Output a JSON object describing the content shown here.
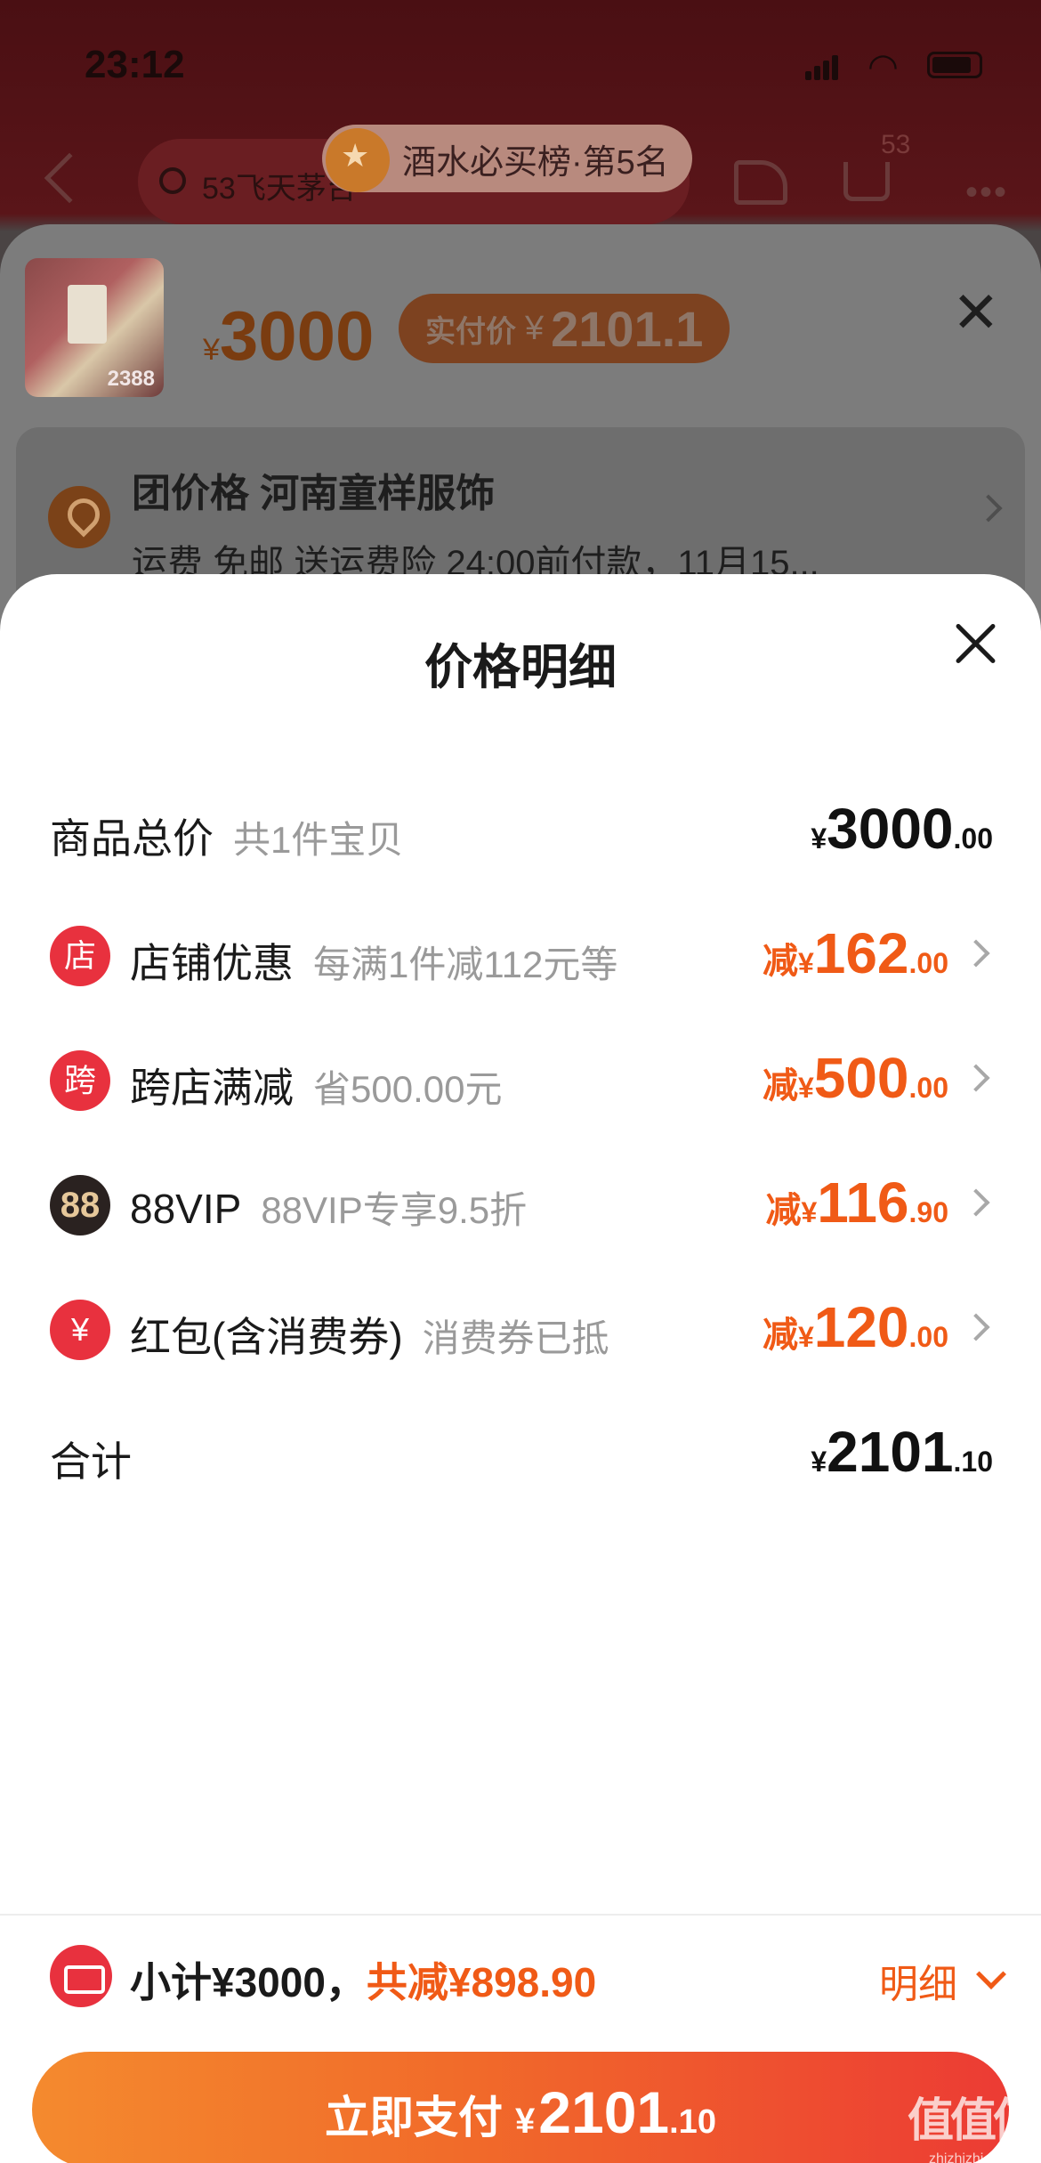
{
  "status_bar": {
    "time": "23:12"
  },
  "nav": {
    "search_text": "53飞天茅台",
    "rank_badge": "酒水必买榜·第5名",
    "cart_count": "53"
  },
  "sku_sheet": {
    "thumb_price": "2388",
    "price_yen": "¥",
    "price": "3000",
    "paid_label": "实付价",
    "paid_yen": "¥",
    "paid_value": "2101.1",
    "close_glyph": "✕",
    "shop_title": "团价格 河南童样服饰",
    "shipping": "运费 免邮 送运费险 24:00前付款，11月15..."
  },
  "price_detail": {
    "title": "价格明细",
    "lines": [
      {
        "label": "商品总价",
        "note": "共1件宝贝",
        "prefix": "",
        "yen": "¥",
        "int": "3000",
        "dec": ".00"
      },
      {
        "icon": "店",
        "label": "店铺优惠",
        "note": "每满1件减112元等",
        "prefix": "减",
        "yen": "¥",
        "int": "162",
        "dec": ".00"
      },
      {
        "icon": "跨",
        "label": "跨店满减",
        "note": "省500.00元",
        "prefix": "减",
        "yen": "¥",
        "int": "500",
        "dec": ".00"
      },
      {
        "icon": "88",
        "label": "88VIP",
        "note": "88VIP专享9.5折",
        "prefix": "减",
        "yen": "¥",
        "int": "116",
        "dec": ".90"
      },
      {
        "icon": "¥",
        "label": "红包(含消费券)",
        "note": "消费券已抵",
        "prefix": "减",
        "yen": "¥",
        "int": "120",
        "dec": ".00"
      },
      {
        "label": "合计",
        "note": "",
        "prefix": "",
        "yen": "¥",
        "int": "2101",
        "dec": ".10"
      }
    ]
  },
  "footer": {
    "subtotal": "小计¥3000，",
    "reduce": "共减¥898.90",
    "detail_toggle": "明细",
    "pay_label": "立即支付",
    "pay_yen": "¥",
    "pay_int": "2101",
    "pay_dec": ".10"
  },
  "watermark": {
    "glyph": "值值值",
    "url": "zhizhizhi.com"
  },
  "colors": {
    "accent": "#f05a16",
    "brand_red": "#e8313e"
  }
}
